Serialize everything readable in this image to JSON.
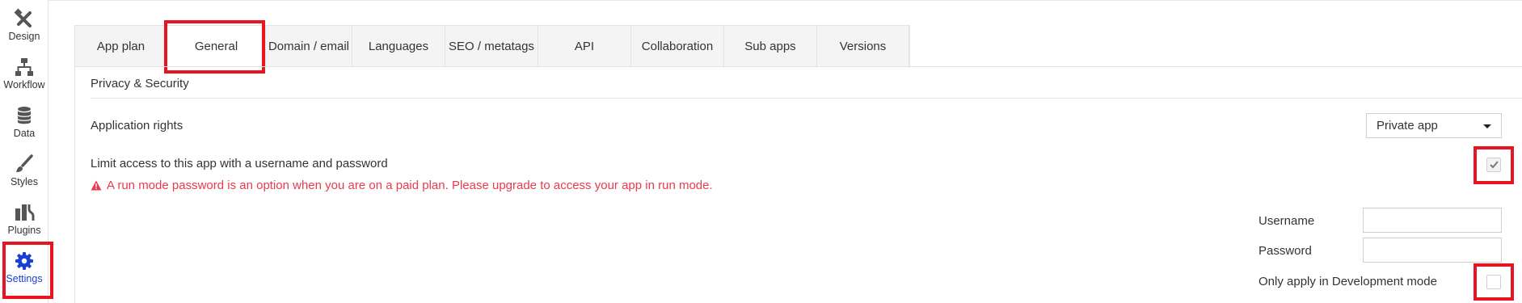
{
  "sidebar": {
    "items": [
      {
        "label": "Design",
        "icon": "design-icon"
      },
      {
        "label": "Workflow",
        "icon": "workflow-icon"
      },
      {
        "label": "Data",
        "icon": "database-icon"
      },
      {
        "label": "Styles",
        "icon": "brush-icon"
      },
      {
        "label": "Plugins",
        "icon": "plug-icon"
      },
      {
        "label": "Settings",
        "icon": "gear-icon"
      }
    ],
    "active": "Settings",
    "active_color": "#1a3fd6"
  },
  "tabs": [
    {
      "label": "App plan"
    },
    {
      "label": "General"
    },
    {
      "label": "Domain / email"
    },
    {
      "label": "Languages"
    },
    {
      "label": "SEO / metatags"
    },
    {
      "label": "API"
    },
    {
      "label": "Collaboration"
    },
    {
      "label": "Sub apps"
    },
    {
      "label": "Versions"
    }
  ],
  "active_tab": "General",
  "section": {
    "title": "Privacy & Security"
  },
  "application_rights": {
    "label": "Application rights",
    "selected": "Private app"
  },
  "limit_access": {
    "label": "Limit access to this app with a username and password",
    "checked": true
  },
  "warning": {
    "text": "A run mode password is an option when you are on a paid plan. Please upgrade to access your app in run mode.",
    "color": "#e83a50"
  },
  "credentials": {
    "username_label": "Username",
    "username_value": "",
    "password_label": "Password",
    "password_value": ""
  },
  "dev_mode": {
    "label": "Only apply in Development mode",
    "checked": false
  },
  "highlight_color": "#e8141f"
}
